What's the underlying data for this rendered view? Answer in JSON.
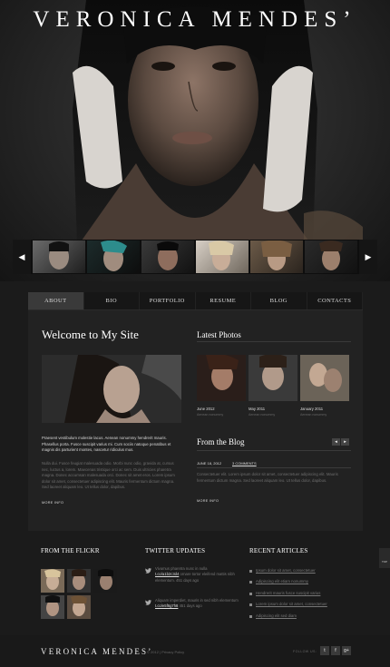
{
  "site": {
    "title": "VERONICA MENDES’"
  },
  "slider": {
    "prev_icon": "arrow-left-icon",
    "next_icon": "arrow-right-icon",
    "thumb_count": 6
  },
  "nav": {
    "items": [
      "ABOUT",
      "BIO",
      "PORTFOLIO",
      "RESUME",
      "BLOG",
      "CONTACTS"
    ],
    "active": "ABOUT"
  },
  "welcome": {
    "heading": "Welcome to My Site",
    "lead": "Praesent vestibulum molestie lacus. Aenean nonummy hendrerit mauris. Phasellus porta. Fusce suscipit varius mi. Cum sociis natoque penatibus et magnis dis parturient montes, nascetur ridiculus mus.",
    "body": "Nulla dui. Fusce feugiat malesuada odio. Morbi nunc odio, gravida at, cursus nec, luctus a, lorem. Maecenas tristique orci ac sem. Duis ultricies pharetra magna. Donec accumsan malesuada orci. Donec sit amet eros. Lorem ipsum dolor sit amet, consectetuer adipiscing elit. Mauris fermentum dictum magna. Sed laoreet aliquam leo. Ut tellus dolor, dapibus.",
    "more": "MORE INFO"
  },
  "latest_photos": {
    "heading": "Latest Photos",
    "items": [
      {
        "date": "June 2012",
        "caption": "Aenean nonummy"
      },
      {
        "date": "May 2011",
        "caption": "Aenean nonummy"
      },
      {
        "date": "January 2011",
        "caption": "Aenean nonummy"
      }
    ]
  },
  "blog": {
    "heading": "From the Blog",
    "date": "JUNE 18, 2012",
    "comments": "3 COMMENTS",
    "text": "Consectetuer elit. Lorem ipsum dolor sit amet, consectetuer adipiscing elit. Mauris fermentum dictum magna. Sed laoreet aliquam leo. Ut tellus dolor, dapibus.",
    "more": "MORE INFO"
  },
  "flickr": {
    "heading": "FROM THE FLICKR",
    "count": 6
  },
  "twitter": {
    "heading": "TWITTER UPDATES",
    "tweets": [
      {
        "text": "Vivamus pharetra nunc in nulla",
        "link": "t.co/a1b2c3d4",
        "tail": "ornare tortor eleifend mattis nibh elementum. 451 days ago"
      },
      {
        "text": "Aliquam imperdiet, mauris in sed nibh elementum",
        "link": "t.co/e5f6g7h8",
        "tail": "451 days ago"
      }
    ]
  },
  "articles": {
    "heading": "RECENT ARTICLES",
    "items": [
      "Ipsum dolor sit amet, consectetuer",
      "Adipiscing elit etiam nonummy",
      "Hendrerit mauris fusce suscipit varius",
      "Lorem ipsum dolor sit amet, consectetuer",
      "Adipiscing elit sed diam"
    ]
  },
  "side_tab": {
    "label": "TOP"
  },
  "footer": {
    "logo": "VERONICA MENDES’",
    "copyright": "© 2012 | Privacy Policy",
    "follow": "FOLLOW US:",
    "social": [
      "twitter-icon",
      "facebook-icon",
      "google-plus-icon"
    ]
  },
  "colors": {
    "background": "#1b1b1b",
    "panel": "#222222",
    "nav_active": "#3a3a3a",
    "heading": "#ffffff"
  }
}
